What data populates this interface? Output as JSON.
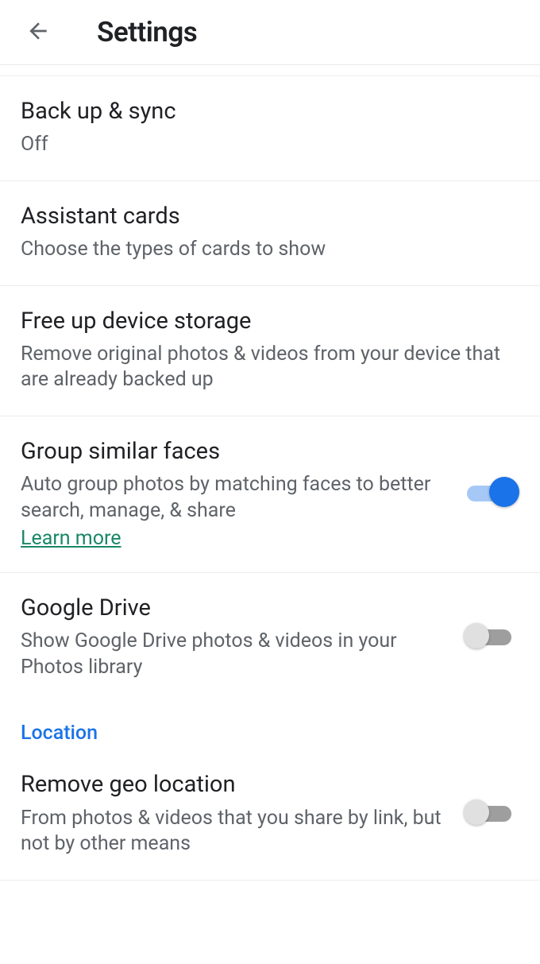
{
  "header": {
    "title": "Settings"
  },
  "items": {
    "backup": {
      "title": "Back up & sync",
      "sub": "Off"
    },
    "assistant": {
      "title": "Assistant cards",
      "sub": "Choose the types of cards to show"
    },
    "freeup": {
      "title": "Free up device storage",
      "sub": "Remove original photos & videos from your device that are already backed up"
    },
    "faces": {
      "title": "Group similar faces",
      "sub": "Auto group photos by matching faces to better search, manage, & share",
      "learn": "Learn more",
      "toggle": true
    },
    "drive": {
      "title": "Google Drive",
      "sub": "Show Google Drive photos & videos in your Photos library",
      "toggle": false
    },
    "geo": {
      "title": "Remove geo location",
      "sub": "From photos & videos that you share by link, but not by other means",
      "toggle": false
    }
  },
  "sections": {
    "location": "Location"
  }
}
